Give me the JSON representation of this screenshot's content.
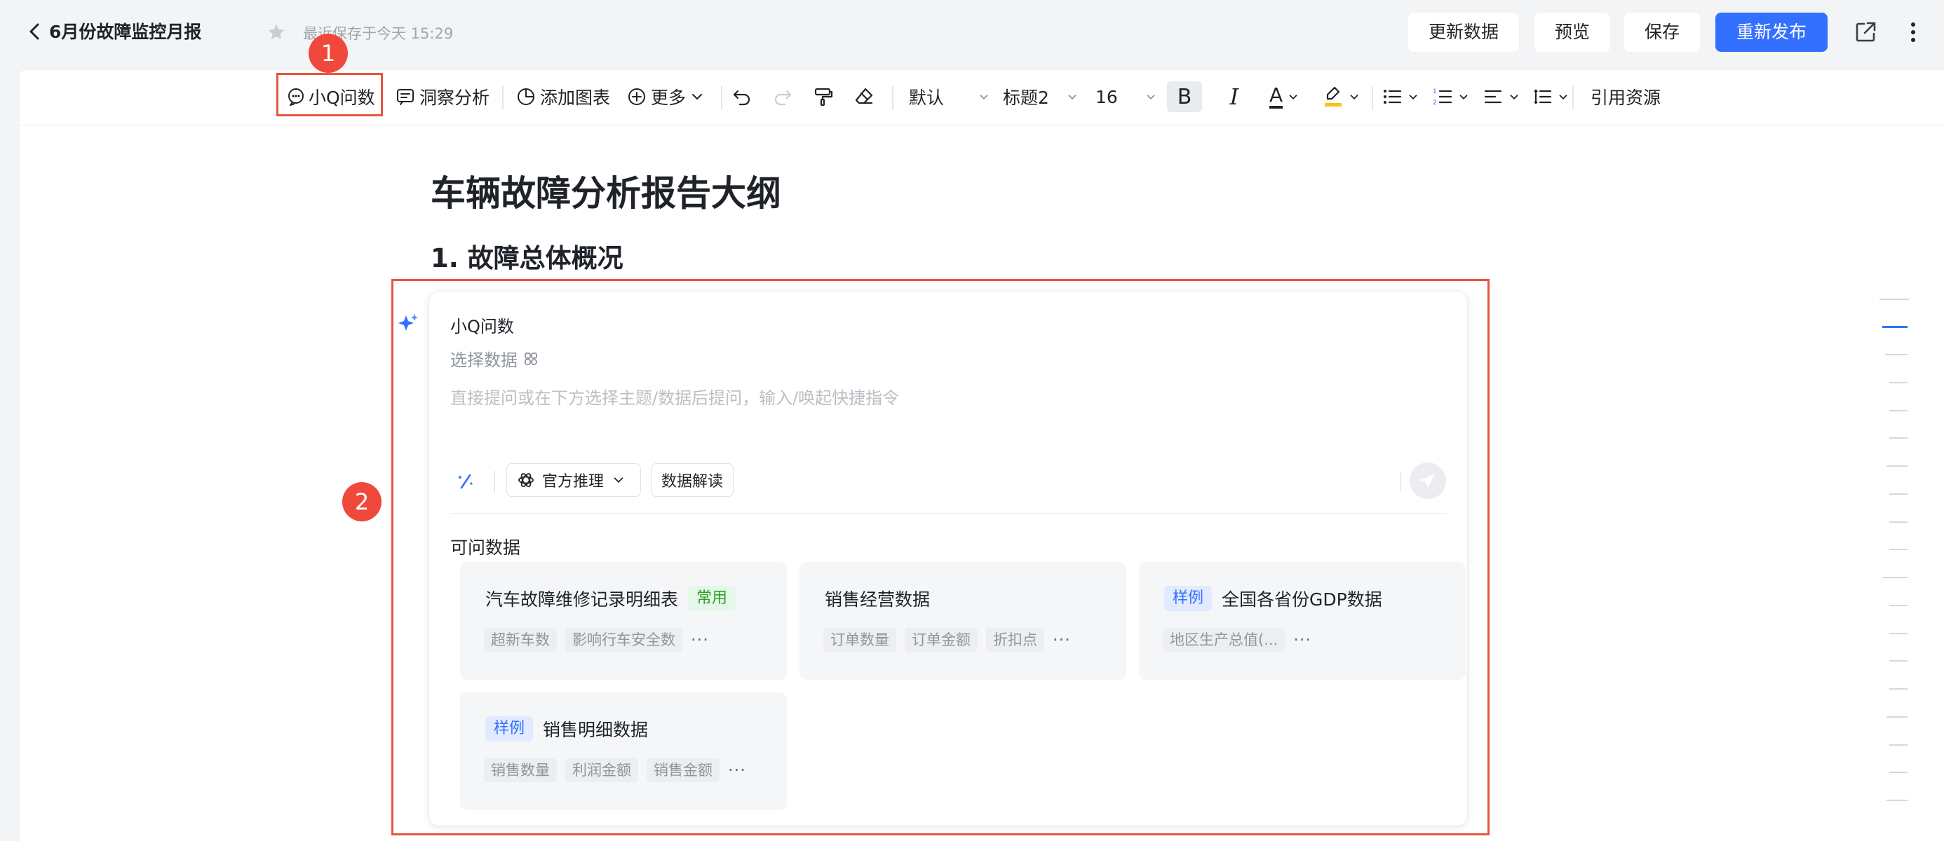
{
  "header": {
    "title": "6月份故障监控月报",
    "save_status": "最近保存于今天 15:29",
    "buttons": {
      "refresh": "更新数据",
      "preview": "预览",
      "save": "保存",
      "republish": "重新发布"
    }
  },
  "toolbar": {
    "ask_q": "小Q问数",
    "insight": "洞察分析",
    "add_chart": "添加图表",
    "more": "更多",
    "style_select": "默认",
    "heading_select": "标题2",
    "font_size": "16",
    "bold": "B",
    "italic": "I",
    "font_color": "A",
    "cite": "引用资源"
  },
  "document": {
    "title": "车辆故障分析报告大纲",
    "section_1": "1. 故障总体概况"
  },
  "ask_panel": {
    "title": "小Q问数",
    "select_data": "选择数据",
    "placeholder": "直接提问或在下方选择主题/数据后提问，输入/唤起快捷指令",
    "official_reasoning": "官方推理",
    "data_interpret": "数据解读",
    "section_label": "可问数据",
    "datasets": [
      {
        "name": "汽车故障维修记录明细表",
        "tag": "常用",
        "fields": [
          "超新车数",
          "影响行车安全数"
        ],
        "more": "···"
      },
      {
        "name": "销售经营数据",
        "tag": "",
        "fields": [
          "订单数量",
          "订单金额",
          "折扣点"
        ],
        "more": "···"
      },
      {
        "name": "全国各省份GDP数据",
        "tag": "样例",
        "fields": [
          "地区生产总值(..."
        ],
        "more": "···"
      },
      {
        "name": "销售明细数据",
        "tag": "样例",
        "fields": [
          "销售数量",
          "利润金额",
          "销售金额"
        ],
        "more": "···"
      }
    ]
  },
  "annotations": {
    "marker_1": "1",
    "marker_2": "2"
  },
  "colors": {
    "accent": "#3370ff",
    "highlight": "#e8553f",
    "marker": "#f0493c",
    "tag_green": "#2ea121"
  }
}
